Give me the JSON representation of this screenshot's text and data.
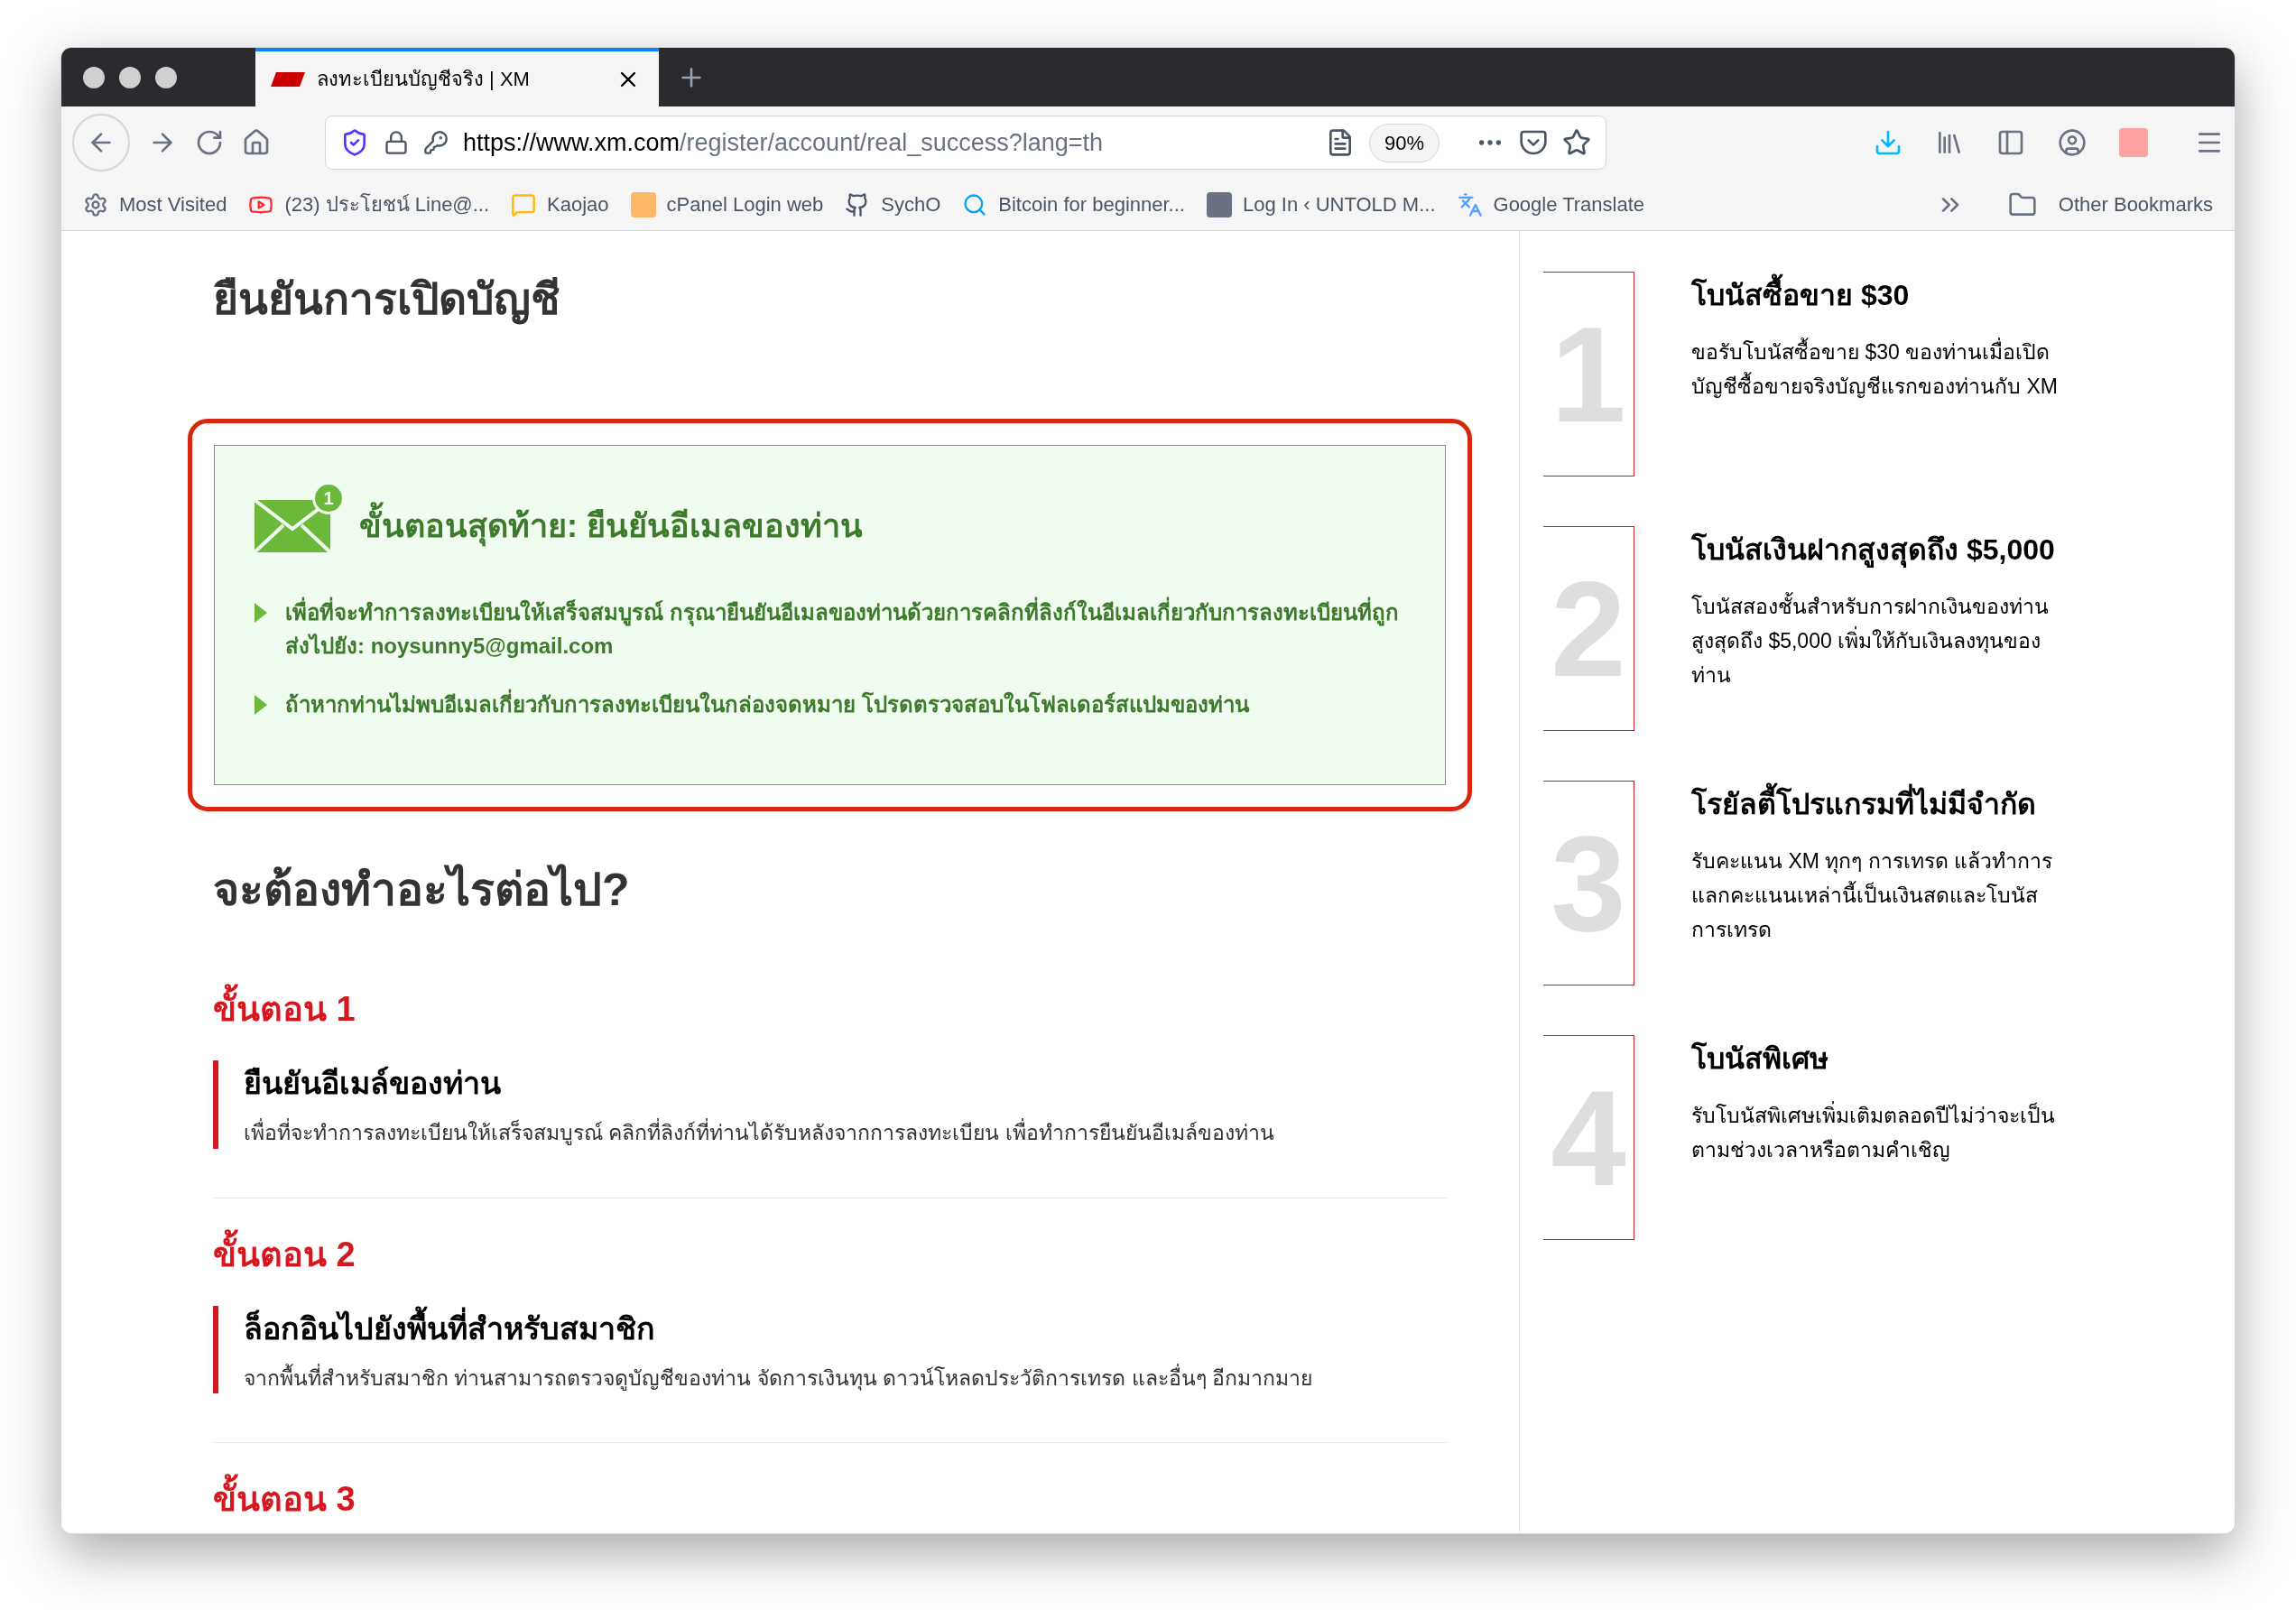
{
  "browser": {
    "tabs": [
      {
        "title": "ลงทะเบียนบัญชีจริง | XM",
        "selected": true
      }
    ],
    "url": {
      "domain": "https://www.xm.com",
      "path": "/register/account/real_success?lang=th"
    },
    "zoom": "90%",
    "bookmarks": [
      {
        "label": "Most Visited"
      },
      {
        "label": "(23) ประโยชน์ Line@..."
      },
      {
        "label": "Kaojao"
      },
      {
        "label": "cPanel Login web"
      },
      {
        "label": "SychO"
      },
      {
        "label": "Bitcoin for beginner..."
      },
      {
        "label": "Log In ‹ UNTOLD M..."
      },
      {
        "label": "Google Translate"
      }
    ],
    "other_bookmarks": "Other Bookmarks"
  },
  "page": {
    "title": "ยืนยันการเปิดบัญชี",
    "notice": {
      "heading": "ขั้นตอนสุดท้าย: ยืนยันอีเมลของท่าน",
      "badge": "1",
      "bullets": [
        "เพื่อที่จะทำการลงทะเบียนให้เสร็จสมบูรณ์ กรุณายืนยันอีเมลของท่านด้วยการคลิกที่ลิงก์ในอีเมลเกี่ยวกับการลงทะเบียนที่ถูกส่งไปยัง: noysunny5@gmail.com",
        "ถ้าหากท่านไม่พบอีเมลเกี่ยวกับการลงทะเบียนในกล่องจดหมาย โปรดตรวจสอบในโฟลเดอร์สแปมของท่าน"
      ]
    },
    "next_heading": "จะต้องทำอะไรต่อไป?",
    "steps": [
      {
        "label": "ขั้นตอน 1",
        "title": "ยืนยันอีเมล์ของท่าน",
        "description": "เพื่อที่จะทำการลงทะเบียนให้เสร็จสมบูรณ์ คลิกที่ลิงก์ที่ท่านได้รับหลังจากการลงทะเบียน เพื่อทำการยืนยันอีเมล์ของท่าน"
      },
      {
        "label": "ขั้นตอน 2",
        "title": "ล็อกอินไปยังพื้นที่สำหรับสมาชิก",
        "description": "จากพื้นที่สำหรับสมาชิก ท่านสามารถตรวจดูบัญชีของท่าน จัดการเงินทุน ดาวน์โหลดประวัติการเทรด และอื่นๆ อีกมากมาย"
      }
    ],
    "cut_step_label": "ขั้นตอน 3",
    "bonuses": [
      {
        "number": "1",
        "title": "โบนัสซื้อขาย $30",
        "description": "ขอรับโบนัสซื้อขาย $30 ของท่านเมื่อเปิดบัญชีซื้อขายจริงบัญชีแรกของท่านกับ XM"
      },
      {
        "number": "2",
        "title": "โบนัสเงินฝากสูงสุดถึง $5,000",
        "description": "โบนัสสองชั้นสำหรับการฝากเงินของท่านสูงสุดถึง $5,000 เพิ่มให้กับเงินลงทุนของท่าน"
      },
      {
        "number": "3",
        "title": "โรยัลตี้โปรแกรมที่ไม่มีจำกัด",
        "description": "รับคะแนน XM ทุกๆ การเทรด แล้วทำการแลกคะแนนเหล่านี้เป็นเงินสดและโบนัสการเทรด"
      },
      {
        "number": "4",
        "title": "โบนัสพิเศษ",
        "description": "รับโบนัสพิเศษเพิ่มเติมตลอดปีไม่ว่าจะเป็นตามช่วงเวลาหรือตามคำเชิญ"
      }
    ]
  }
}
